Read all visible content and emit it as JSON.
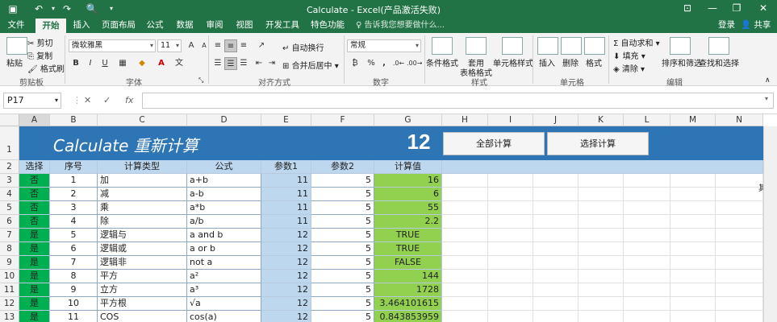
{
  "window": {
    "title": "Calculate - Excel(产品激活失败)",
    "qa_icons": [
      "save-icon",
      "undo-icon",
      "redo-icon",
      "print-preview-icon",
      "customize-icon"
    ],
    "controls": {
      "ribbon_options": "⊡",
      "minimize": "—",
      "restore": "❐",
      "close": "✕"
    }
  },
  "tabs": [
    "文件",
    "开始",
    "插入",
    "页面布局",
    "公式",
    "数据",
    "审阅",
    "视图",
    "开发工具",
    "特色功能"
  ],
  "active_tab": "开始",
  "tell_me": "♀ 告诉我您想要做什么...",
  "account": {
    "login": "登录",
    "share": "共享"
  },
  "ribbon": {
    "clipboard": {
      "paste": "粘贴",
      "cut": "剪切",
      "copy": "复制",
      "format_painter": "格式刷",
      "label": "剪贴板"
    },
    "font": {
      "name": "微软雅黑",
      "size": "11",
      "grow": "A",
      "shrink": "A",
      "bold": "B",
      "italic": "I",
      "underline": "U",
      "label": "字体"
    },
    "alignment": {
      "wrap": "自动换行",
      "merge": "合并后居中",
      "label": "对齐方式"
    },
    "number": {
      "format": "常规",
      "pct": "%",
      "comma": ",",
      "label": "数字"
    },
    "styles": {
      "conditional": "条件格式",
      "table": "套用",
      "table2": "表格格式",
      "cell_styles": "单元格样式",
      "label": "样式"
    },
    "cells": {
      "insert": "插入",
      "delete": "删除",
      "format": "格式",
      "label": "单元格"
    },
    "editing": {
      "autosum": "自动求和",
      "fill": "填充",
      "clear": "清除",
      "sort": "排序和筛选",
      "find": "查找和选择",
      "label": "编辑"
    }
  },
  "formula_bar": {
    "name_box": "P17",
    "cancel": "✕",
    "enter": "✓",
    "fx": "fx",
    "content": ""
  },
  "columns": [
    "A",
    "B",
    "C",
    "D",
    "E",
    "F",
    "G",
    "H",
    "I",
    "J",
    "K",
    "L",
    "M",
    "N"
  ],
  "selected_column": "A",
  "rows": [
    "1",
    "2",
    "3",
    "4",
    "5",
    "6",
    "7",
    "8",
    "9",
    "10",
    "11",
    "12",
    "13"
  ],
  "banner": {
    "title": "Calculate 重新计算",
    "count": "12",
    "btn_all": "全部计算",
    "btn_sel": "选择计算"
  },
  "headers": [
    "选择",
    "序号",
    "计算类型",
    "公式",
    "参数1",
    "参数2",
    "计算值"
  ],
  "data_rows": [
    {
      "sel": "否",
      "no": "1",
      "type": "加",
      "formula": "a+b",
      "p1": "11",
      "p2": "5",
      "val": "16",
      "valalign": "right"
    },
    {
      "sel": "否",
      "no": "2",
      "type": "减",
      "formula": "a-b",
      "p1": "11",
      "p2": "5",
      "val": "6",
      "valalign": "right"
    },
    {
      "sel": "否",
      "no": "3",
      "type": "乘",
      "formula": "a*b",
      "p1": "11",
      "p2": "5",
      "val": "55",
      "valalign": "right"
    },
    {
      "sel": "否",
      "no": "4",
      "type": "除",
      "formula": "a/b",
      "p1": "11",
      "p2": "5",
      "val": "2.2",
      "valalign": "right"
    },
    {
      "sel": "是",
      "no": "5",
      "type": "逻辑与",
      "formula": "a and b",
      "p1": "12",
      "p2": "5",
      "val": "TRUE",
      "valalign": "center"
    },
    {
      "sel": "是",
      "no": "6",
      "type": "逻辑或",
      "formula": "a or b",
      "p1": "12",
      "p2": "5",
      "val": "TRUE",
      "valalign": "center"
    },
    {
      "sel": "是",
      "no": "7",
      "type": "逻辑非",
      "formula": "not a",
      "p1": "12",
      "p2": "5",
      "val": "FALSE",
      "valalign": "center"
    },
    {
      "sel": "是",
      "no": "8",
      "type": "平方",
      "formula": "a²",
      "p1": "12",
      "p2": "5",
      "val": "144",
      "valalign": "right"
    },
    {
      "sel": "是",
      "no": "9",
      "type": "立方",
      "formula": "a³",
      "p1": "12",
      "p2": "5",
      "val": "1728",
      "valalign": "right"
    },
    {
      "sel": "是",
      "no": "10",
      "type": "平方根",
      "formula": "√a",
      "p1": "12",
      "p2": "5",
      "val": "3.464101615",
      "valalign": "right"
    },
    {
      "sel": "是",
      "no": "11",
      "type": "COS",
      "formula": "cos(a)",
      "p1": "12",
      "p2": "5",
      "val": "0.843853959",
      "valalign": "right"
    }
  ],
  "clipped_text": "其"
}
